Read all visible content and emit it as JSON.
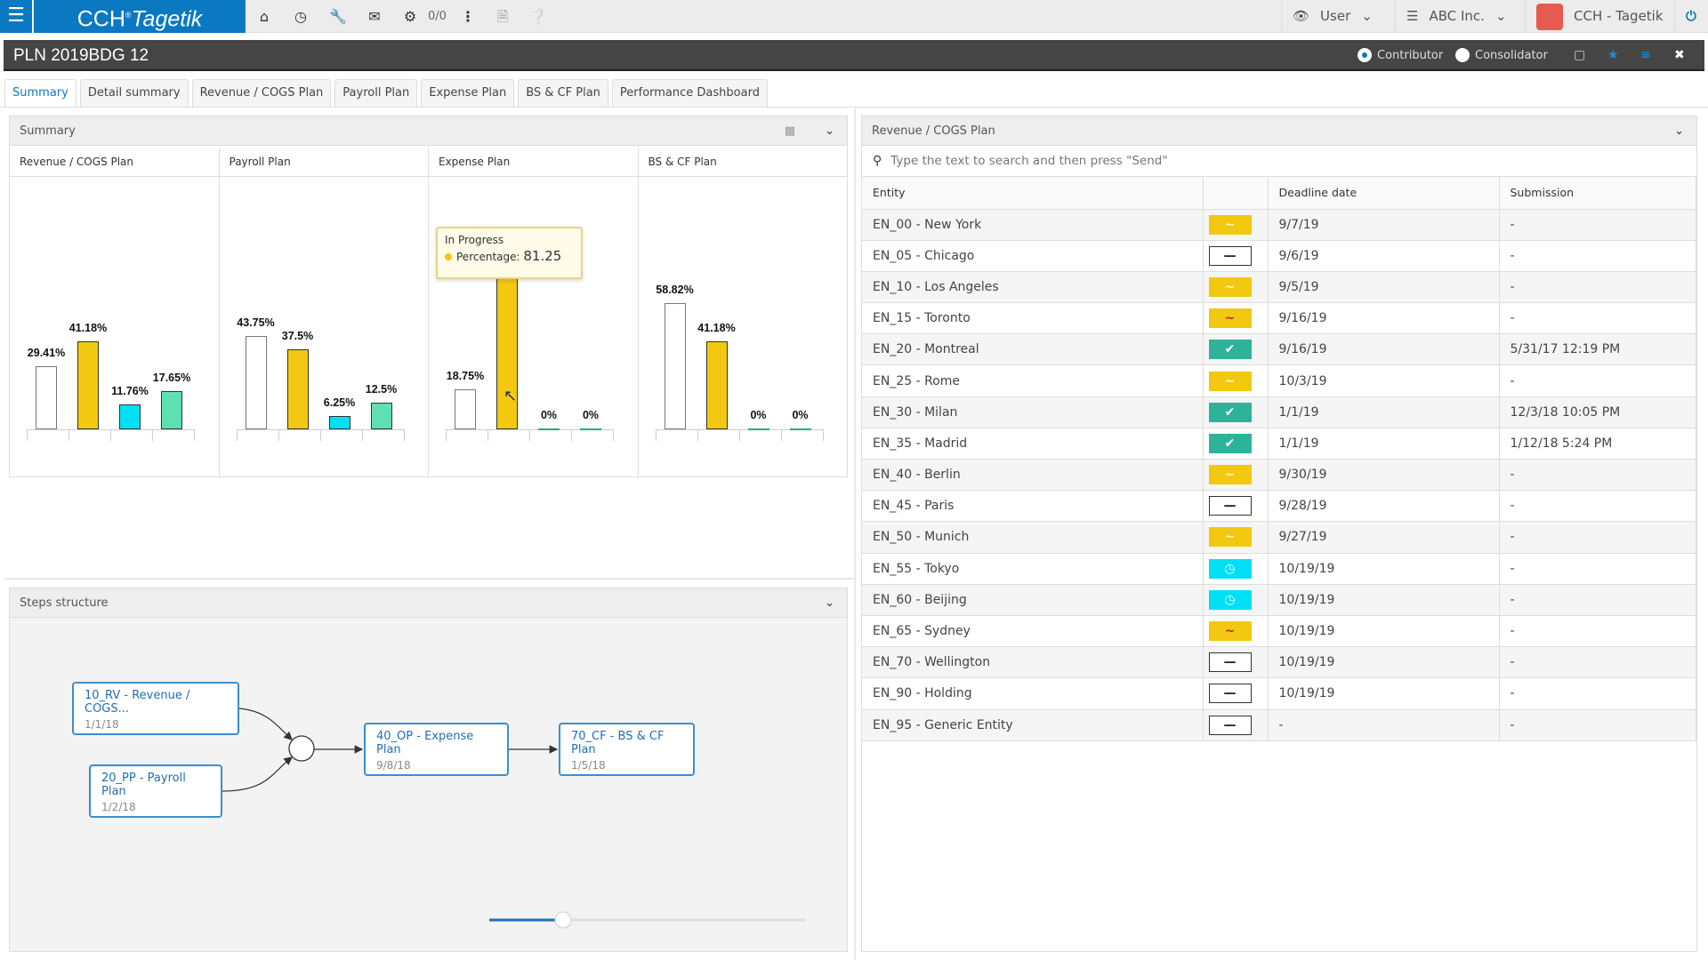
{
  "topbar": {
    "brand_main": "CCH",
    "brand_italic": "Tagetik",
    "tasks_count": "0/0",
    "user_label": "User",
    "company_label": "ABC Inc.",
    "account_label": "CCH - Tagetik"
  },
  "titlebar": {
    "title": "PLN 2019BDG 12",
    "radio_contributor": "Contributor",
    "radio_consolidator": "Consolidator",
    "selected_role": "Contributor"
  },
  "tabs": [
    {
      "label": "Summary",
      "active": true
    },
    {
      "label": "Detail summary"
    },
    {
      "label": "Revenue / COGS Plan"
    },
    {
      "label": "Payroll Plan"
    },
    {
      "label": "Expense Plan"
    },
    {
      "label": "BS & CF Plan"
    },
    {
      "label": "Performance Dashboard"
    }
  ],
  "summary": {
    "title": "Summary",
    "tooltip": {
      "status": "In Progress",
      "label": "Percentage:",
      "value": "81.25"
    },
    "colors": {
      "not_started": "#ffffff",
      "in_progress": "#f2c811",
      "in_review": "#00e0f5",
      "completed": "#5fe0b0"
    }
  },
  "chart_data": [
    {
      "type": "bar",
      "title": "Revenue / COGS Plan",
      "values": [
        29.41,
        41.18,
        11.76,
        17.65
      ],
      "labels": [
        "29.41%",
        "41.18%",
        "11.76%",
        "17.65%"
      ],
      "ylim": [
        0,
        100
      ]
    },
    {
      "type": "bar",
      "title": "Payroll Plan",
      "values": [
        43.75,
        37.5,
        6.25,
        12.5
      ],
      "labels": [
        "43.75%",
        "37.5%",
        "6.25%",
        "12.5%"
      ],
      "ylim": [
        0,
        100
      ]
    },
    {
      "type": "bar",
      "title": "Expense Plan",
      "values": [
        18.75,
        81.25,
        0,
        0
      ],
      "labels": [
        "18.75%",
        "81.25%",
        "0%",
        "0%"
      ],
      "ylim": [
        0,
        100
      ]
    },
    {
      "type": "bar",
      "title": "BS & CF Plan",
      "values": [
        58.82,
        41.18,
        0,
        0
      ],
      "labels": [
        "58.82%",
        "41.18%",
        "0%",
        "0%"
      ],
      "ylim": [
        0,
        100
      ]
    }
  ],
  "steps": {
    "title": "Steps structure",
    "nodes": [
      {
        "label": "10_RV - Revenue / COGS...",
        "date": "1/1/18"
      },
      {
        "label": "20_PP - Payroll Plan",
        "date": "1/2/18"
      },
      {
        "label": "40_OP - Expense Plan",
        "date": "9/8/18"
      },
      {
        "label": "70_CF - BS & CF Plan",
        "date": "1/5/18"
      }
    ],
    "zoom_level": 0.3
  },
  "revenue": {
    "title": "Revenue / COGS Plan",
    "search_placeholder": "Type the text to search and then press \"Send\"",
    "columns": [
      "Entity",
      "",
      "Deadline date",
      "Submission"
    ],
    "rows": [
      {
        "entity": "EN_00 - New York",
        "status": "in-progress",
        "deadline": "9/7/19",
        "submission": "-"
      },
      {
        "entity": "EN_05 - Chicago",
        "status": "not-started",
        "deadline": "9/6/19",
        "submission": "-"
      },
      {
        "entity": "EN_10 - Los Angeles",
        "status": "in-progress",
        "deadline": "9/5/19",
        "submission": "-"
      },
      {
        "entity": "EN_15 - Toronto",
        "status": "in-progress-late",
        "deadline": "9/16/19",
        "submission": "-"
      },
      {
        "entity": "EN_20 - Montreal",
        "status": "completed",
        "deadline": "9/16/19",
        "submission": "5/31/17 12:19 PM"
      },
      {
        "entity": "EN_25 - Rome",
        "status": "in-progress",
        "deadline": "10/3/19",
        "submission": "-"
      },
      {
        "entity": "EN_30 - Milan",
        "status": "completed",
        "deadline": "1/1/19",
        "submission": "12/3/18 10:05 PM"
      },
      {
        "entity": "EN_35 - Madrid",
        "status": "completed",
        "deadline": "1/1/19",
        "submission": "1/12/18 5:24 PM"
      },
      {
        "entity": "EN_40 - Berlin",
        "status": "in-progress",
        "deadline": "9/30/19",
        "submission": "-"
      },
      {
        "entity": "EN_45 - Paris",
        "status": "not-started",
        "deadline": "9/28/19",
        "submission": "-"
      },
      {
        "entity": "EN_50 - Munich",
        "status": "in-progress",
        "deadline": "9/27/19",
        "submission": "-"
      },
      {
        "entity": "EN_55 - Tokyo",
        "status": "in-review",
        "deadline": "10/19/19",
        "submission": "-"
      },
      {
        "entity": "EN_60 - Beijing",
        "status": "in-review",
        "deadline": "10/19/19",
        "submission": "-"
      },
      {
        "entity": "EN_65 - Sydney",
        "status": "in-progress-late",
        "deadline": "10/19/19",
        "submission": "-"
      },
      {
        "entity": "EN_70 - Wellington",
        "status": "not-started",
        "deadline": "10/19/19",
        "submission": "-"
      },
      {
        "entity": "EN_90 - Holding",
        "status": "not-started",
        "deadline": "10/19/19",
        "submission": "-"
      },
      {
        "entity": "EN_95 - Generic Entity",
        "status": "not-started",
        "deadline": "-",
        "submission": "-"
      }
    ]
  }
}
